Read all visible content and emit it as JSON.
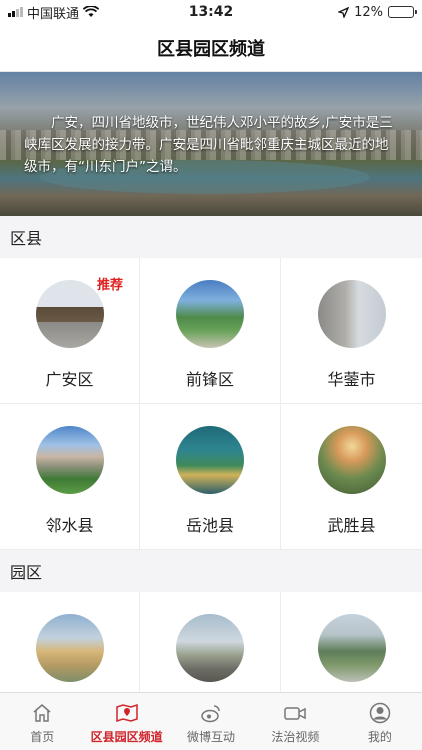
{
  "status_bar": {
    "carrier": "中国联通",
    "time": "13:42",
    "battery_percent": "12%",
    "battery_level": 0.12
  },
  "header": {
    "title": "区县园区频道"
  },
  "banner": {
    "text": "广安，四川省地级市，世纪伟人邓小平的故乡,广安市是三峡库区发展的接力带。广安是四川省毗邻重庆主城区最近的地级市，有“川东门户”之谓。"
  },
  "districts": {
    "heading": "区县",
    "items": [
      {
        "name": "广安区",
        "badge": "推荐"
      },
      {
        "name": "前锋区"
      },
      {
        "name": "华蓥市"
      },
      {
        "name": "邻水县"
      },
      {
        "name": "岳池县"
      },
      {
        "name": "武胜县"
      }
    ]
  },
  "parks": {
    "heading": "园区"
  },
  "tabbar": {
    "items": [
      {
        "label": "首页",
        "icon": "home-icon"
      },
      {
        "label": "区县园区频道",
        "icon": "map-pin-icon",
        "active": true
      },
      {
        "label": "微博互动",
        "icon": "weibo-icon"
      },
      {
        "label": "法治视频",
        "icon": "video-camera-icon"
      },
      {
        "label": "我的",
        "icon": "user-icon"
      }
    ]
  },
  "colors": {
    "accent": "#d0232a",
    "badge": "#e02020"
  }
}
